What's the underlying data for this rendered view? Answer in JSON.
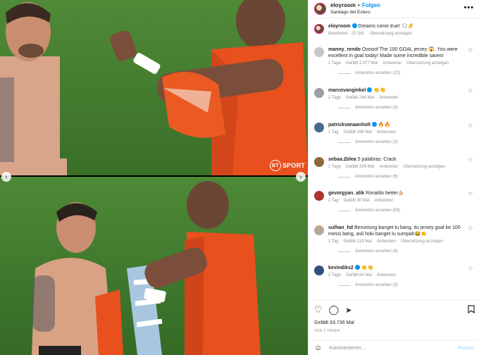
{
  "header": {
    "username": "eloyroom",
    "separator": "•",
    "follow_label": "Folgen",
    "location": "Santiago del Estero",
    "more_label": "•••"
  },
  "media": {
    "watermark": "SPORT",
    "watermark_badge": "BT",
    "prev_icon": "chevron-left-icon",
    "next_icon": "chevron-right-icon"
  },
  "caption": {
    "username": "eloyroom",
    "text": "Dreams come true! 🗨🤌",
    "time": "Bearbeitet · 22 Std.",
    "translate": "Übersetzung anzeigen"
  },
  "comments": [
    {
      "username": "manny_rendo",
      "text": "Ooooof The 100 GOAL jersey 😱. You were excellent in goal today! Made some incredible saves!",
      "time": "2 Tage",
      "likes": "Gefällt 1.077 Mal",
      "reply": "Antworten",
      "translate": "Übersetzung anzeigen",
      "replies": "Antworten ansehen (22)"
    },
    {
      "username": "marcovanginkel",
      "text": "👏👏",
      "time": "2 Tage",
      "likes": "Gefällt 246 Mal",
      "reply": "Antworten",
      "replies": "Antworten ansehen (3)"
    },
    {
      "username": "patrickvanaanholt",
      "text": "🔥🔥",
      "time": "1 Tag",
      "likes": "Gefällt 246 Mal",
      "reply": "Antworten",
      "replies": "Antworten ansehen (2)"
    },
    {
      "username": "sebaa.2blea",
      "text": "5 palabras: Crack",
      "time": "2 Tage",
      "likes": "Gefällt 209 Mal",
      "reply": "Antworten",
      "translate": "Übersetzung anzeigen",
      "replies": "Antworten ansehen (6)"
    },
    {
      "username": "gevorgyan_alik",
      "text": "Ronaldo better🫵🏻",
      "time": "1 Tag",
      "likes": "Gefällt 30 Mal",
      "reply": "Antworten",
      "replies": "Antworten ansehen (58)"
    },
    {
      "username": "sulhan_hd",
      "text": "Beruntung banget lu bang, itu jersey goal ke 100 messi bang, asli hoki banget lu sumpah😂👏",
      "time": "1 Tag",
      "likes": "Gefällt 219 Mal",
      "reply": "Antworten",
      "translate": "Übersetzung anzeigen",
      "replies": "Antworten ansehen (8)"
    },
    {
      "username": "kevindiks2",
      "text": "👏👏",
      "time": "2 Tage",
      "likes": "Gefällt 84 Mal",
      "reply": "Antworten",
      "replies": "Antworten ansehen (3)"
    }
  ],
  "actions": {
    "like_icon": "heart-icon",
    "comment_icon": "comment-icon",
    "share_icon": "share-icon",
    "save_icon": "bookmark-icon"
  },
  "likes_total": "Gefällt 93.736 Mal",
  "date": "VOR 2 TAGEN",
  "add_comment": {
    "placeholder": "Kommentieren ...",
    "post_label": "Posten"
  },
  "colors": {
    "link": "#0095f6",
    "muted": "#8e8e8e",
    "jersey": "#e8501e",
    "grass": "#3f7a2c"
  }
}
